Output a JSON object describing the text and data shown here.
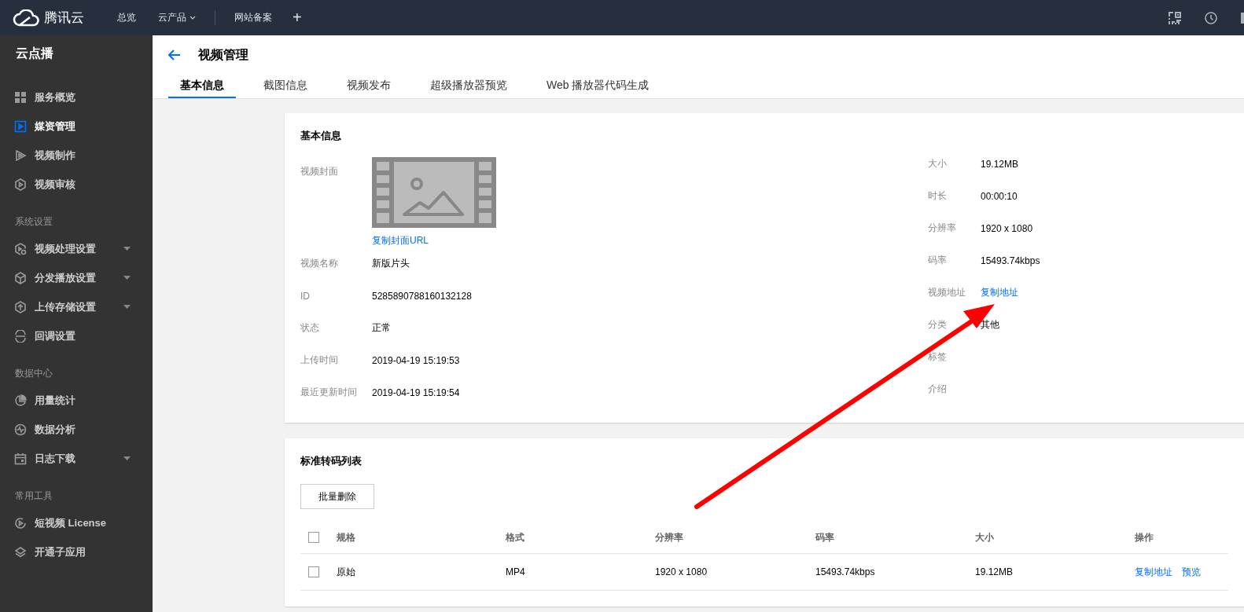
{
  "topbar": {
    "brand": "腾讯云",
    "nav": [
      {
        "label": "总览",
        "dropdown": false
      },
      {
        "label": "云产品",
        "dropdown": true
      },
      {
        "label": "网站备案",
        "dropdown": false
      }
    ],
    "add": "+"
  },
  "sidebar": {
    "title": "云点播",
    "sections": [
      {
        "items": [
          {
            "label": "服务概览",
            "selected": false,
            "submenu": false
          },
          {
            "label": "媒资管理",
            "selected": true,
            "submenu": false
          },
          {
            "label": "视频制作",
            "selected": false,
            "submenu": false
          },
          {
            "label": "视频审核",
            "selected": false,
            "submenu": false
          }
        ]
      },
      {
        "heading": "系统设置",
        "items": [
          {
            "label": "视频处理设置",
            "selected": false,
            "submenu": true
          },
          {
            "label": "分发播放设置",
            "selected": false,
            "submenu": true
          },
          {
            "label": "上传存储设置",
            "selected": false,
            "submenu": true
          },
          {
            "label": "回调设置",
            "selected": false,
            "submenu": false
          }
        ]
      },
      {
        "heading": "数据中心",
        "items": [
          {
            "label": "用量统计",
            "selected": false,
            "submenu": false
          },
          {
            "label": "数据分析",
            "selected": false,
            "submenu": false
          },
          {
            "label": "日志下载",
            "selected": false,
            "submenu": true
          }
        ]
      },
      {
        "heading": "常用工具",
        "items": [
          {
            "label": "短视频 License",
            "selected": false,
            "submenu": false
          },
          {
            "label": "开通子应用",
            "selected": false,
            "submenu": false
          }
        ]
      }
    ]
  },
  "header": {
    "title": "视频管理"
  },
  "tabs": [
    {
      "label": "基本信息",
      "selected": true
    },
    {
      "label": "截图信息",
      "selected": false
    },
    {
      "label": "视频发布",
      "selected": false
    },
    {
      "label": "超级播放器预览",
      "selected": false
    },
    {
      "label": "Web 播放器代码生成",
      "selected": false
    }
  ],
  "basic_info": {
    "title": "基本信息",
    "cover": {
      "label": "视频封面",
      "link": "复制封面URL"
    },
    "left_fields": [
      {
        "label": "视频名称",
        "value": "新版片头"
      },
      {
        "label": "ID",
        "value": "5285890788160132128"
      },
      {
        "label": "状态",
        "value": "正常"
      },
      {
        "label": "上传时间",
        "value": "2019-04-19 15:19:53"
      },
      {
        "label": "最近更新时间",
        "value": "2019-04-19 15:19:54"
      }
    ],
    "right_fields": [
      {
        "label": "大小",
        "value": "19.12MB",
        "kind": "text"
      },
      {
        "label": "时长",
        "value": "00:00:10",
        "kind": "text"
      },
      {
        "label": "分辨率",
        "value": "1920 x 1080",
        "kind": "text"
      },
      {
        "label": "码率",
        "value": "15493.74kbps",
        "kind": "text"
      },
      {
        "label": "视频地址",
        "value": "复制地址",
        "kind": "link"
      },
      {
        "label": "分类",
        "value": "其他",
        "kind": "text"
      },
      {
        "label": "标签"
      },
      {
        "label": "介绍"
      }
    ]
  },
  "transcode": {
    "title": "标准转码列表",
    "batch_delete": "批量删除",
    "select_all": false,
    "columns": [
      "规格",
      "格式",
      "分辨率",
      "码率",
      "大小",
      "操作"
    ],
    "rows": [
      {
        "selected": false,
        "cells": [
          "原始",
          "MP4",
          "1920 x 1080",
          "15493.74kbps",
          "19.12MB"
        ],
        "actions": [
          "复制地址",
          "预览"
        ]
      }
    ]
  }
}
